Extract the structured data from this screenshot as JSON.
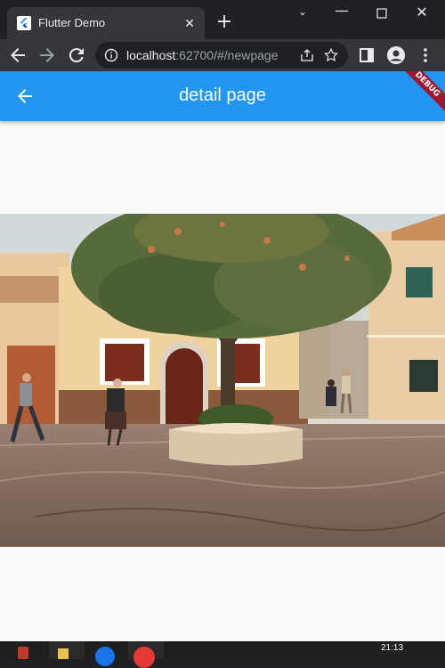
{
  "browser": {
    "tab_title": "Flutter Demo",
    "url_host": "localhost",
    "url_rest": ":62700/#/newpage",
    "icons": {
      "favicon": "flutter-logo-icon",
      "close": "close-icon",
      "new_tab": "plus-icon",
      "back": "arrow-left-icon",
      "forward": "arrow-right-icon",
      "reload": "reload-icon",
      "info": "info-icon",
      "share": "share-icon",
      "bookmark": "star-icon",
      "side_panel": "side-panel-icon",
      "profile": "profile-icon",
      "menu": "kebab-menu-icon"
    }
  },
  "app": {
    "title": "detail page",
    "debug_banner": "DEBUG",
    "colors": {
      "appbar": "#2196f3",
      "background": "#fafafa",
      "debug": "#a0182f"
    }
  },
  "photo": {
    "subject": "village square with tree, buildings and people walking"
  },
  "taskbar": {
    "time": "21:13"
  }
}
